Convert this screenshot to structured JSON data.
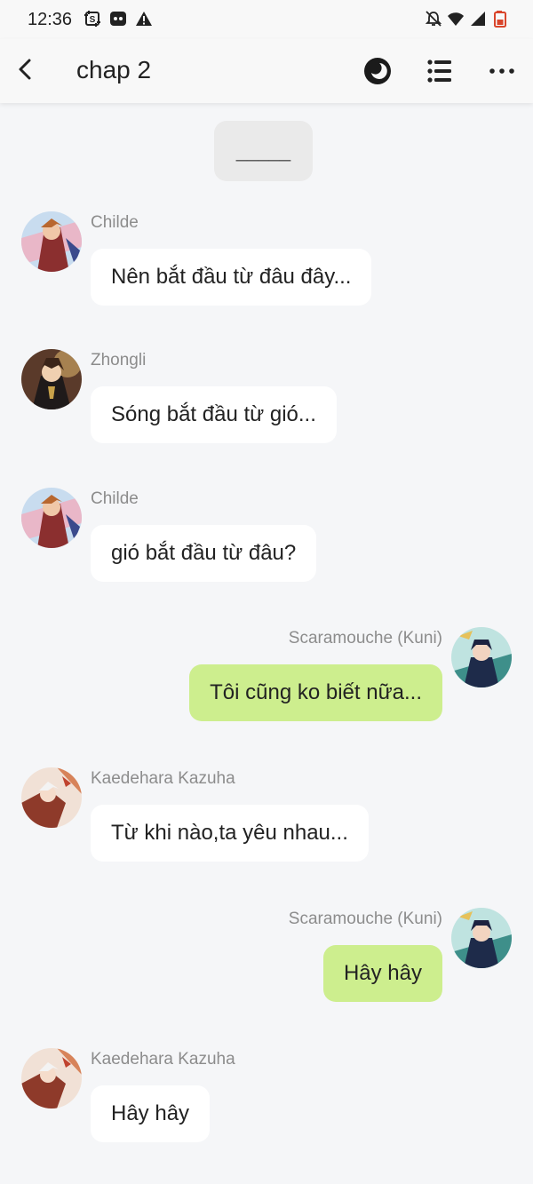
{
  "status_bar": {
    "time": "12:36",
    "icons_left": [
      "screenshot-icon",
      "discord-icon",
      "warning-icon"
    ],
    "icons_right": [
      "notifications-off-icon",
      "wifi-icon",
      "signal-icon",
      "battery-icon"
    ]
  },
  "app_bar": {
    "title": "chap 2",
    "back_icon": "chevron-left-icon",
    "theme_icon": "dark-mode-icon",
    "list_icon": "list-icon",
    "more_icon": "more-horizontal-icon"
  },
  "chat": {
    "divider_text": "_____",
    "messages": [
      {
        "side": "left",
        "sender": "Childe",
        "text": "Nên bắt đầu từ đâu đây..."
      },
      {
        "side": "left",
        "sender": "Zhongli",
        "text": "Sóng bắt đầu từ gió..."
      },
      {
        "side": "left",
        "sender": "Childe",
        "text": "gió bắt đầu từ đâu?"
      },
      {
        "side": "right",
        "sender": "Scaramouche (Kuni)",
        "text": "Tôi cũng ko biết nữa..."
      },
      {
        "side": "left",
        "sender": "Kaedehara Kazuha",
        "text": "Từ khi nào,ta yêu nhau..."
      },
      {
        "side": "right",
        "sender": "Scaramouche (Kuni)",
        "text": "Hây hây"
      },
      {
        "side": "left",
        "sender": "Kaedehara Kazuha",
        "text": "Hây hây"
      }
    ]
  },
  "colors": {
    "background": "#f5f6f8",
    "bubble_left": "#ffffff",
    "bubble_right": "#cdee8e",
    "sender_text": "#8c8c8c"
  }
}
